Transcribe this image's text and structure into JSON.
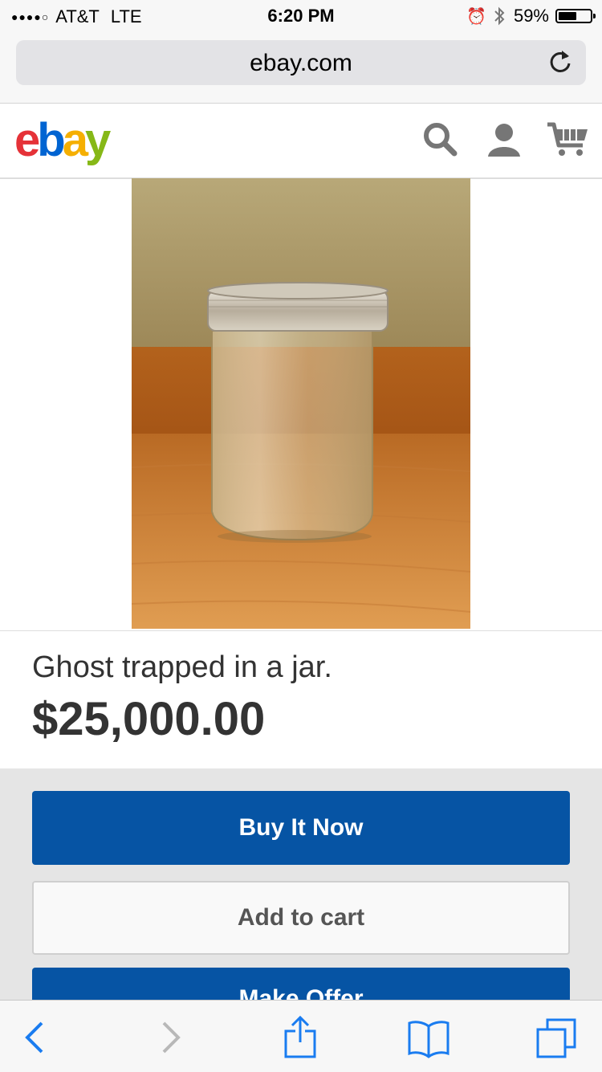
{
  "status_bar": {
    "signal": "●●●●○",
    "carrier": "AT&T",
    "network": "LTE",
    "time": "6:20 PM",
    "battery": "59%",
    "battery_level": 0.59
  },
  "browser": {
    "url": "ebay.com"
  },
  "header": {
    "logo": [
      "e",
      "b",
      "a",
      "y"
    ],
    "logo_colors": [
      "#e53238",
      "#0064d2",
      "#f5af02",
      "#86b817"
    ],
    "icons": [
      "search-icon",
      "account-icon",
      "cart-icon"
    ]
  },
  "listing": {
    "title": "Ghost trapped in a jar.",
    "price": "$25,000.00"
  },
  "actions": {
    "buy_now": "Buy It Now",
    "add_to_cart": "Add to cart",
    "make_offer": "Make Offer"
  },
  "toolbar": {
    "icons": [
      "back-icon",
      "forward-icon",
      "share-icon",
      "bookmarks-icon",
      "tabs-icon"
    ]
  },
  "colors": {
    "primary_button": "#0654a4",
    "accent_ios": "#1a7cf0"
  }
}
